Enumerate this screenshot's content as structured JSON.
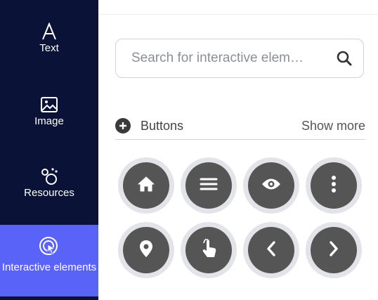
{
  "sidebar": {
    "items": [
      {
        "label": "Text",
        "icon": "text-icon"
      },
      {
        "label": "Image",
        "icon": "image-icon"
      },
      {
        "label": "Resources",
        "icon": "resources-icon"
      },
      {
        "label": "Interactive elements",
        "icon": "interactive-elements-icon",
        "active": true
      }
    ]
  },
  "search": {
    "placeholder": "Search for interactive elem…"
  },
  "section": {
    "title": "Buttons",
    "show_more": "Show more"
  },
  "buttons": [
    {
      "icon": "home-icon"
    },
    {
      "icon": "menu-icon"
    },
    {
      "icon": "eye-icon"
    },
    {
      "icon": "more-vertical-icon"
    },
    {
      "icon": "location-pin-icon"
    },
    {
      "icon": "pointer-hand-icon"
    },
    {
      "icon": "chevron-left-icon"
    },
    {
      "icon": "chevron-right-icon"
    }
  ],
  "colors": {
    "sidebar_bg": "#0a1337",
    "active_bg": "#5a63f7",
    "button_fill": "#555555",
    "button_ring": "#e3e4e9"
  }
}
